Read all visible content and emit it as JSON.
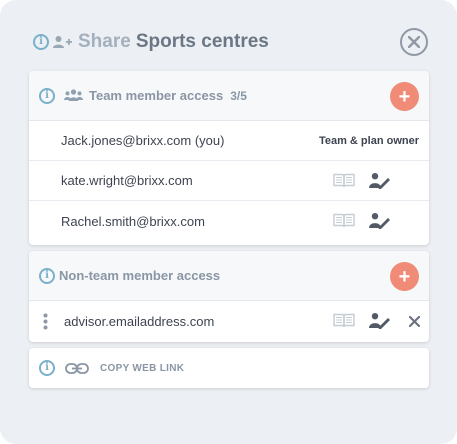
{
  "header": {
    "share_label": "Share",
    "title": "Sports centres",
    "icons": [
      "info-icon",
      "add-user-icon",
      "close-icon"
    ]
  },
  "team_section": {
    "title": "Team member access",
    "count": "3/5",
    "add_icon": "+",
    "members": [
      {
        "email": "Jack.jones@brixx.com (you)",
        "role": "Team & plan owner"
      },
      {
        "email": "kate.wright@brixx.com"
      },
      {
        "email": "Rachel.smith@brixx.com"
      }
    ]
  },
  "non_team_section": {
    "title": "Non-team member access",
    "add_icon": "+",
    "members": [
      {
        "email": "advisor.emailaddress.com"
      }
    ]
  },
  "web_link": {
    "label": "COPY WEB LINK"
  },
  "colors": {
    "accent": "#ef8b76",
    "info": "#7ab0c9",
    "panel_bg": "#eceff3",
    "icon_grey": "#9aa5b1",
    "icon_dark": "#525a66"
  }
}
